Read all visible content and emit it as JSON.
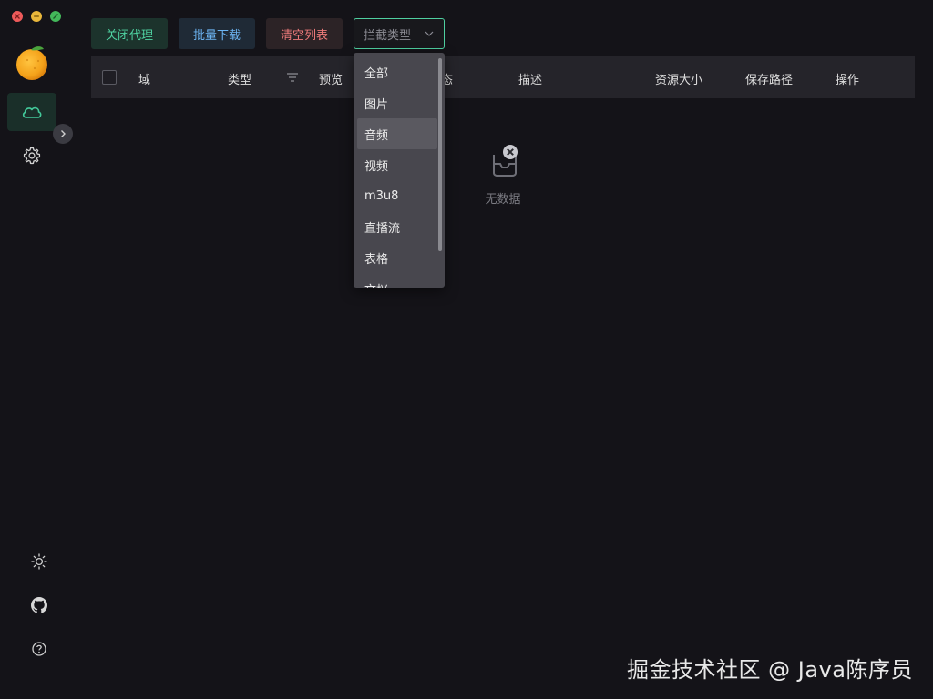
{
  "toolbar": {
    "proxy_label": "关闭代理",
    "download_label": "批量下载",
    "clear_label": "清空列表",
    "intercept_select": {
      "placeholder": "拦截类型"
    }
  },
  "table": {
    "columns": {
      "domain": "域",
      "type": "类型",
      "preview": "预览",
      "status": "态",
      "description": "描述",
      "size": "资源大小",
      "save_path": "保存路径",
      "action": "操作"
    },
    "empty_text": "无数据"
  },
  "dropdown": {
    "options": [
      "全部",
      "图片",
      "音频",
      "视频",
      "m3u8",
      "直播流",
      "表格",
      "文档"
    ],
    "highlighted": "音频"
  },
  "sidebar": {
    "logo": "orange-logo",
    "items": [
      {
        "name": "cloud-icon",
        "active": true
      },
      {
        "name": "gear-icon",
        "active": false
      }
    ],
    "bottom": [
      "sun-icon",
      "github-icon",
      "help-icon"
    ]
  },
  "watermark": "掘金技术社区 @ Java陈序员",
  "colors": {
    "background": "#141318",
    "accent": "#4fd3a2",
    "download": "#6cb4f2",
    "danger": "#ec7a7a"
  }
}
